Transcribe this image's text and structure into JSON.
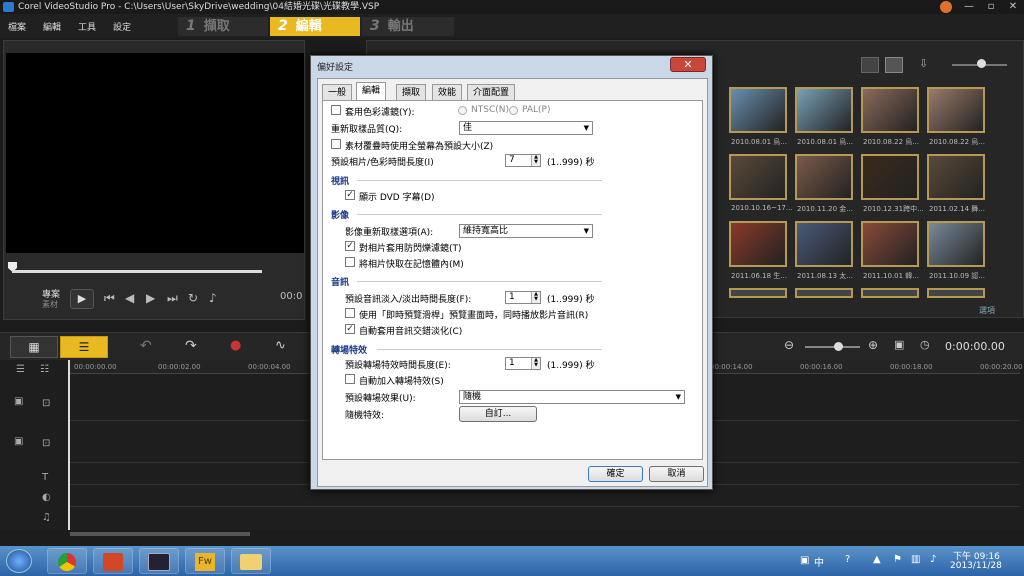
{
  "window": {
    "title": "Corel VideoStudio Pro - C:\\Users\\User\\SkyDrive\\wedding\\04結婚光碟\\光碟教學.VSP"
  },
  "menu": [
    "檔案",
    "編輯",
    "工具",
    "設定"
  ],
  "steps": [
    {
      "num": "1",
      "label": "擷取"
    },
    {
      "num": "2",
      "label": "編輯"
    },
    {
      "num": "3",
      "label": "輸出"
    }
  ],
  "preview": {
    "mode_project": "專案",
    "mode_clip": "素材",
    "timecode": "00:0"
  },
  "library": {
    "captions": [
      "2010.08.01 烏...",
      "2010.08.01 烏...",
      "2010.08.22 烏...",
      "2010.08.22 烏...",
      "2010.10.16~17...",
      "2010.11.20 金...",
      "2010.12.31跨中...",
      "2011.02.14 舞...",
      "2011.06.18 生...",
      "2011.08.13 太...",
      "2011.10.01 韓...",
      "2011.10.09 認..."
    ],
    "options_label": "選項"
  },
  "timeline": {
    "timecode": "0:00:00.00",
    "ruler": [
      "00:00:00.00",
      "00:00:02.00",
      "00:00:04.00",
      "00:00:14.00",
      "00:00:16.00",
      "00:00:18.00",
      "00:00:20.00"
    ]
  },
  "dialog": {
    "title": "偏好設定",
    "close": "✕",
    "tabs": [
      "一般",
      "編輯",
      "擷取",
      "效能",
      "介面配置"
    ],
    "apply_color_filter": "套用色彩濾鏡(Y):",
    "ntsc": "NTSC(N)",
    "pal": "PAL(P)",
    "resample_quality_label": "重新取樣品質(Q):",
    "resample_quality_value": "佳",
    "fit_clip": "素材覆疊時使用全螢幕為預設大小(Z)",
    "default_duration_label": "預設相片/色彩時間長度(I)",
    "default_duration_value": "7",
    "range_hint": "(1..999) 秒",
    "video_section": "視訊",
    "show_dvd_subtitle": "顯示 DVD 字幕(D)",
    "image_section": "影像",
    "image_resample_label": "影像重新取樣選項(A):",
    "image_resample_value": "維持寬高比",
    "anti_flicker": "對相片套用防閃爍濾鏡(T)",
    "cache_photos": "將相片快取在記憶體內(M)",
    "audio_section": "音訊",
    "audio_fade_label": "預設音訊淡入/淡出時間長度(F):",
    "audio_fade_value": "1",
    "instant_playback": "使用「即時預覽滑桿」預覽畫面時，同時播放影片音訊(R)",
    "auto_crossfade": "自動套用音訊交錯淡化(C)",
    "transition_section": "轉場特效",
    "transition_duration_label": "預設轉場特效時間長度(E):",
    "transition_duration_value": "1",
    "auto_add_transition": "自動加入轉場特效(S)",
    "default_transition_label": "預設轉場效果(U):",
    "default_transition_value": "隨機",
    "random_effect_label": "隨機特效:",
    "customize_button": "自訂...",
    "ok_button": "確定",
    "cancel_button": "取消"
  },
  "taskbar": {
    "lang": "中",
    "time": "下午 09:16",
    "date": "2013/11/28"
  }
}
